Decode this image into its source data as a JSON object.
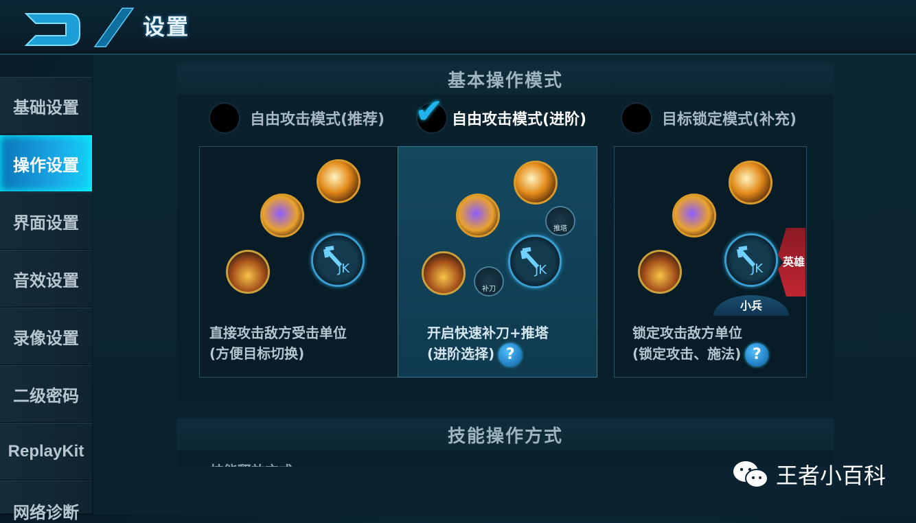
{
  "header": {
    "title": "设置"
  },
  "sidebar": {
    "items": [
      {
        "label": "基础设置"
      },
      {
        "label": "操作设置"
      },
      {
        "label": "界面设置"
      },
      {
        "label": "音效设置"
      },
      {
        "label": "录像设置"
      },
      {
        "label": "二级密码"
      },
      {
        "label": "ReplayKit"
      },
      {
        "label": "网络诊断"
      }
    ],
    "active_index": 1
  },
  "section_basic": {
    "title": "基本操作模式",
    "modes": [
      {
        "label": "自由攻击模式(推荐)",
        "selected": false
      },
      {
        "label": "自由攻击模式(进阶)",
        "selected": true
      },
      {
        "label": "目标锁定模式(补充)",
        "selected": false
      }
    ],
    "cards": [
      {
        "line1": "直接攻击敌方受击单位",
        "line2": "(方便目标切换)"
      },
      {
        "line1": "开启快速补刀+推塔",
        "line2": "(进阶选择)",
        "help": "?",
        "badge_last_hit": "补刀",
        "badge_tower": "推塔"
      },
      {
        "line1": "锁定攻击敌方单位",
        "line2": "(锁定攻击、施法)",
        "help": "?",
        "ribbon_hero": "英雄",
        "tab_minion": "小兵"
      }
    ]
  },
  "section_skill": {
    "title": "技能操作方式",
    "subtitle_partial": "技能释放方式"
  },
  "watermark": {
    "text": "王者小百科",
    "icon": "wechat-icon"
  },
  "colors": {
    "accent": "#1aa6e6",
    "check": "#21b3ec",
    "ribbon": "#c02632"
  }
}
